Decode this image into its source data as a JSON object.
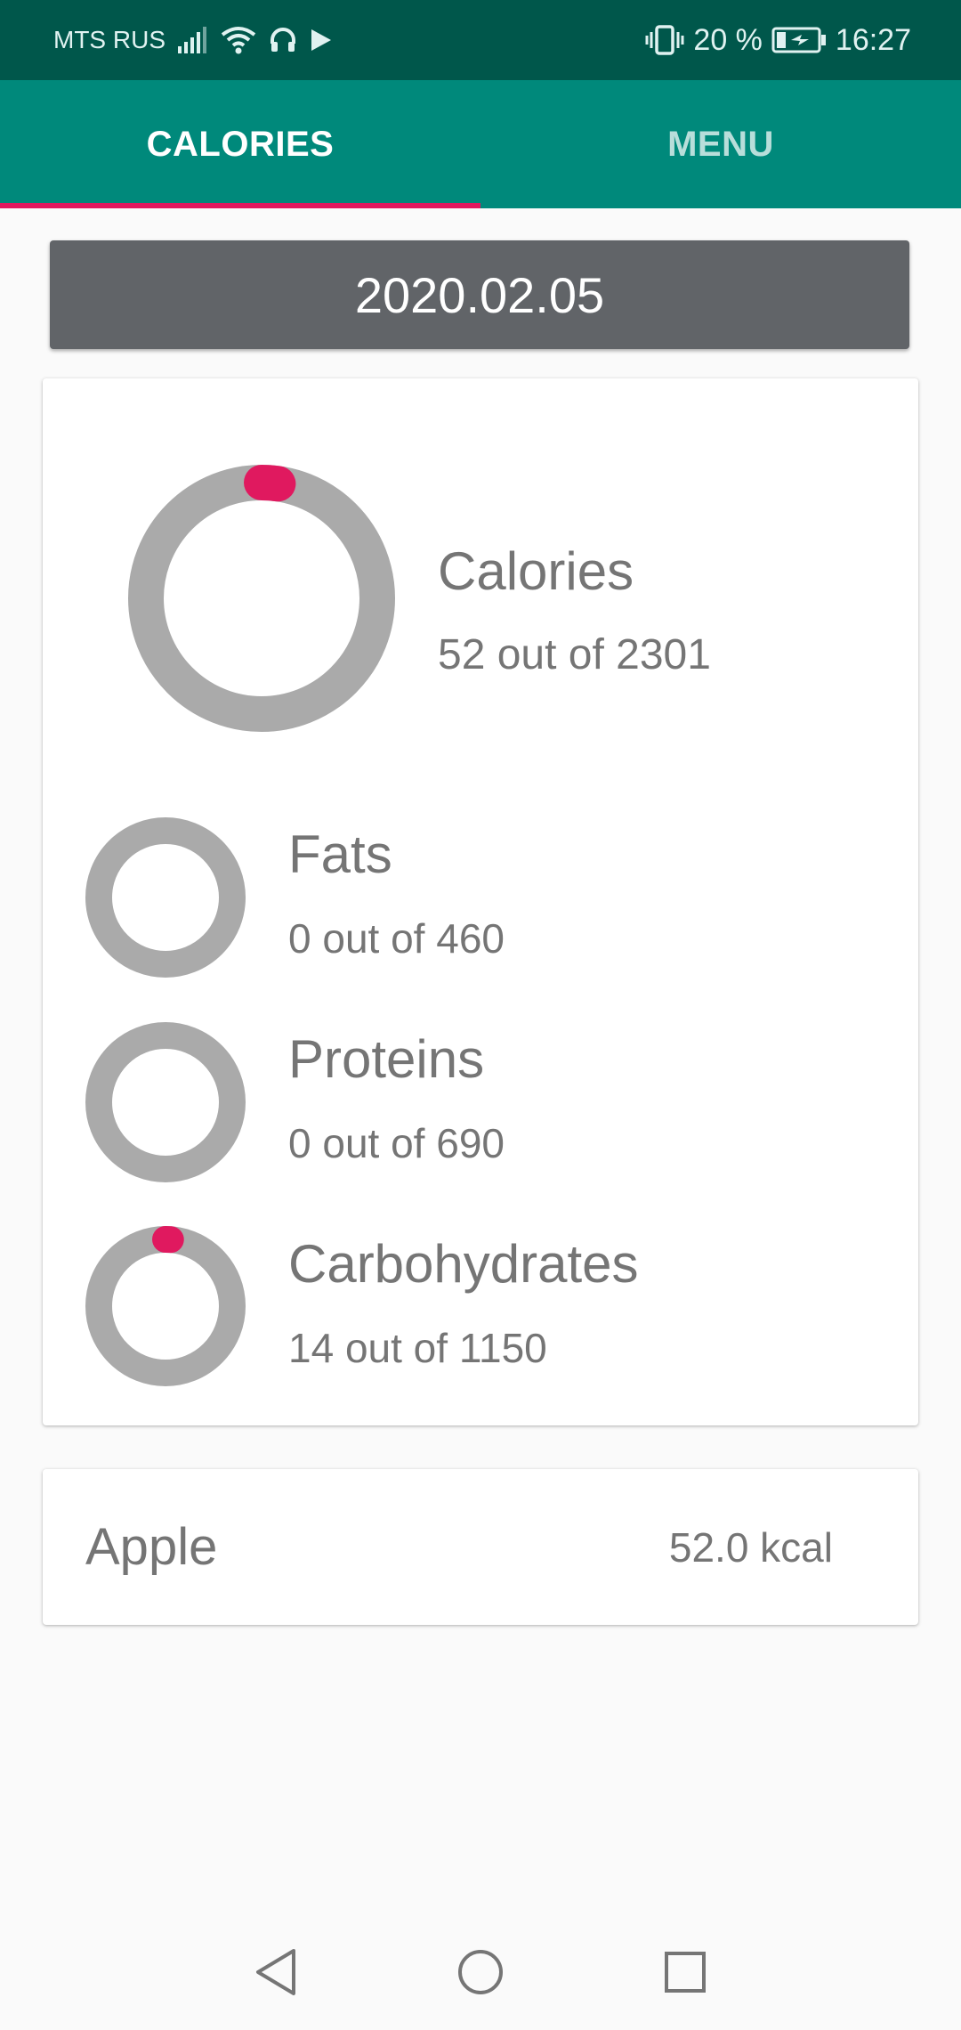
{
  "status_bar": {
    "carrier": "MTS RUS",
    "battery_percent": "20 %",
    "time": "16:27",
    "icons": [
      "signal-icon",
      "wifi-icon",
      "headset-icon",
      "play-icon",
      "vibrate-icon",
      "battery-icon"
    ]
  },
  "tabs": [
    {
      "label": "CALORIES",
      "active": true
    },
    {
      "label": "MENU",
      "active": false
    }
  ],
  "date": "2020.02.05",
  "colors": {
    "primary": "#00897b",
    "primary_dark": "#00574b",
    "accent": "#e0195f",
    "ring_track": "#aaaaaa",
    "date_button": "#616468"
  },
  "stats": {
    "calories": {
      "title": "Calories",
      "summary": "52 out of 2301",
      "current": 52,
      "goal": 2301
    },
    "fats": {
      "title": "Fats",
      "summary": "0 out of 460",
      "current": 0,
      "goal": 460
    },
    "proteins": {
      "title": "Proteins",
      "summary": "0 out of 690",
      "current": 0,
      "goal": 690
    },
    "carbohydrates": {
      "title": "Carbohydrates",
      "summary": "14 out of 1150",
      "current": 14,
      "goal": 1150
    }
  },
  "food_items": [
    {
      "name": "Apple",
      "kcal": "52.0 kcal"
    }
  ],
  "nav": [
    "back-icon",
    "home-icon",
    "recents-icon"
  ]
}
